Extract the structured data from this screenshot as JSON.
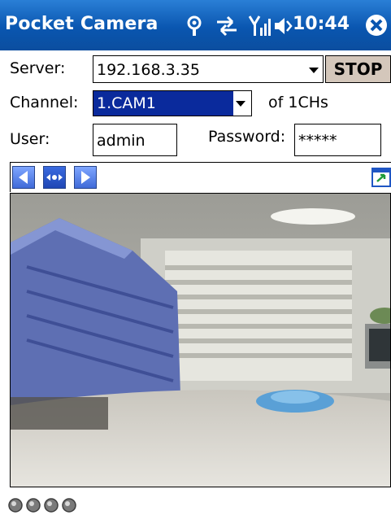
{
  "titlebar": {
    "app_title": "Pocket Camera",
    "time": "10:44",
    "icons": [
      "connectivity-icon",
      "sync-icon",
      "signal-icon",
      "volume-icon",
      "close-icon"
    ]
  },
  "form": {
    "server_label": "Server:",
    "server_value": "192.168.3.35",
    "stop_label": "STOP",
    "channel_label": "Channel:",
    "channel_value": "1.CAM1",
    "channel_suffix": "of 1CHs",
    "user_label": "User:",
    "user_value": "admin",
    "password_label": "Password:",
    "password_value": "*****"
  },
  "toolbar": {
    "icons": [
      "arrow-left-icon",
      "move-icon",
      "arrow-right-icon",
      "window-icon"
    ]
  },
  "video": {
    "description_icon": "camera-feed"
  },
  "status": {
    "dots_count": 4
  }
}
